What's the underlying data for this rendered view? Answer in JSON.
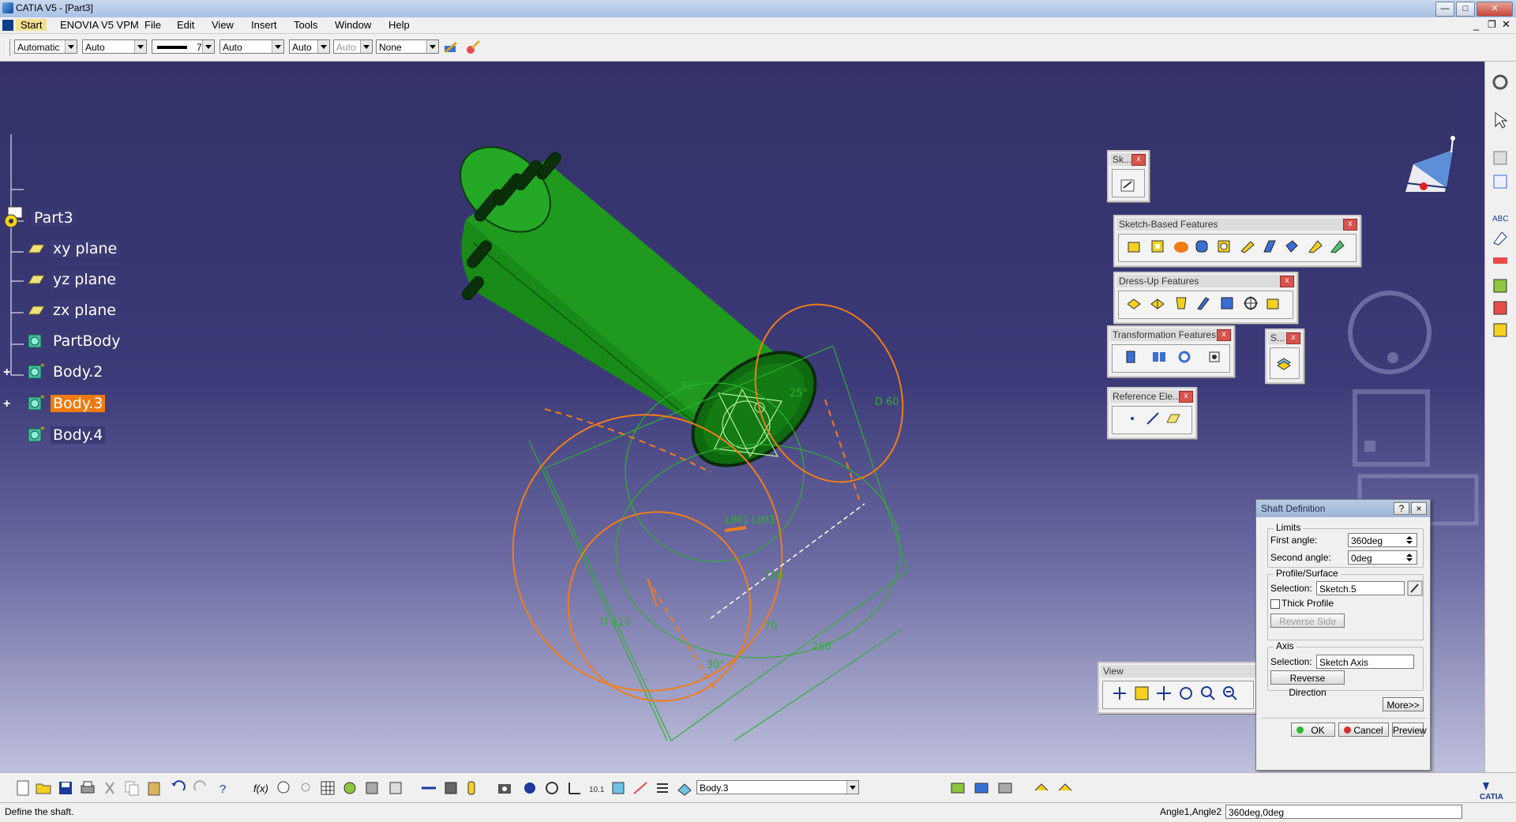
{
  "window": {
    "title": "CATIA V5 - [Part3]"
  },
  "menubar": {
    "items": [
      "Start",
      "ENOVIA V5 VPM",
      "File",
      "Edit",
      "View",
      "Insert",
      "Tools",
      "Window",
      "Help"
    ]
  },
  "graphic_properties": {
    "color": "Automatic",
    "transparency": "Auto",
    "line_weight": "7",
    "line_type": "Auto",
    "point_symbol": "Auto",
    "layer_disabled": "Auto",
    "rendering": "None"
  },
  "tree": {
    "root": "Part3",
    "items": [
      {
        "label": "xy plane",
        "icon": "plane-icon"
      },
      {
        "label": "yz plane",
        "icon": "plane-icon"
      },
      {
        "label": "zx plane",
        "icon": "plane-icon"
      },
      {
        "label": "PartBody",
        "icon": "body-icon"
      },
      {
        "label": "Body.2",
        "icon": "body-icon"
      },
      {
        "label": "Body.3",
        "icon": "body-icon",
        "selected": true
      },
      {
        "label": "Body.4",
        "icon": "body-icon"
      }
    ]
  },
  "dimensions": [
    "D 60",
    "D 110",
    "25°",
    "30°",
    "70",
    "30°",
    "100",
    "250",
    "LIM1",
    "LIM1"
  ],
  "toolbars": {
    "sketcher": "Sk...",
    "sketch_based": "Sketch-Based Features",
    "dress_up": "Dress-Up Features",
    "transformation": "Transformation Features",
    "surface": "S...",
    "reference": "Reference Ele...",
    "view": "View"
  },
  "dialog": {
    "title": "Shaft Definition",
    "help": "?",
    "close": "×",
    "limits_group": "Limits",
    "first_angle_label": "First angle:",
    "first_angle_value": "360deg",
    "second_angle_label": "Second angle:",
    "second_angle_value": "0deg",
    "profile_group": "Profile/Surface",
    "profile_selection_label": "Selection:",
    "profile_selection_value": "Sketch.5",
    "thick_profile_label": "Thick Profile",
    "thick_profile_checked": false,
    "reverse_side_label": "Reverse Side",
    "axis_group": "Axis",
    "axis_selection_label": "Selection:",
    "axis_selection_value": "Sketch Axis",
    "reverse_direction_label": "Reverse Direction",
    "more_label": "More>>",
    "ok_label": "OK",
    "cancel_label": "Cancel",
    "preview_label": "Preview"
  },
  "bottom_toolbar": {
    "current_body": "Body.3"
  },
  "status": {
    "message": "Define the shaft.",
    "prompt_label": "Angle1,Angle2",
    "prompt_value": "360deg,0deg"
  },
  "colors": {
    "viewport_top": "#333168",
    "part_green": "#1e9e1e",
    "sketch_orange": "#f07d1a",
    "selection_orange": "#ef7b10"
  }
}
